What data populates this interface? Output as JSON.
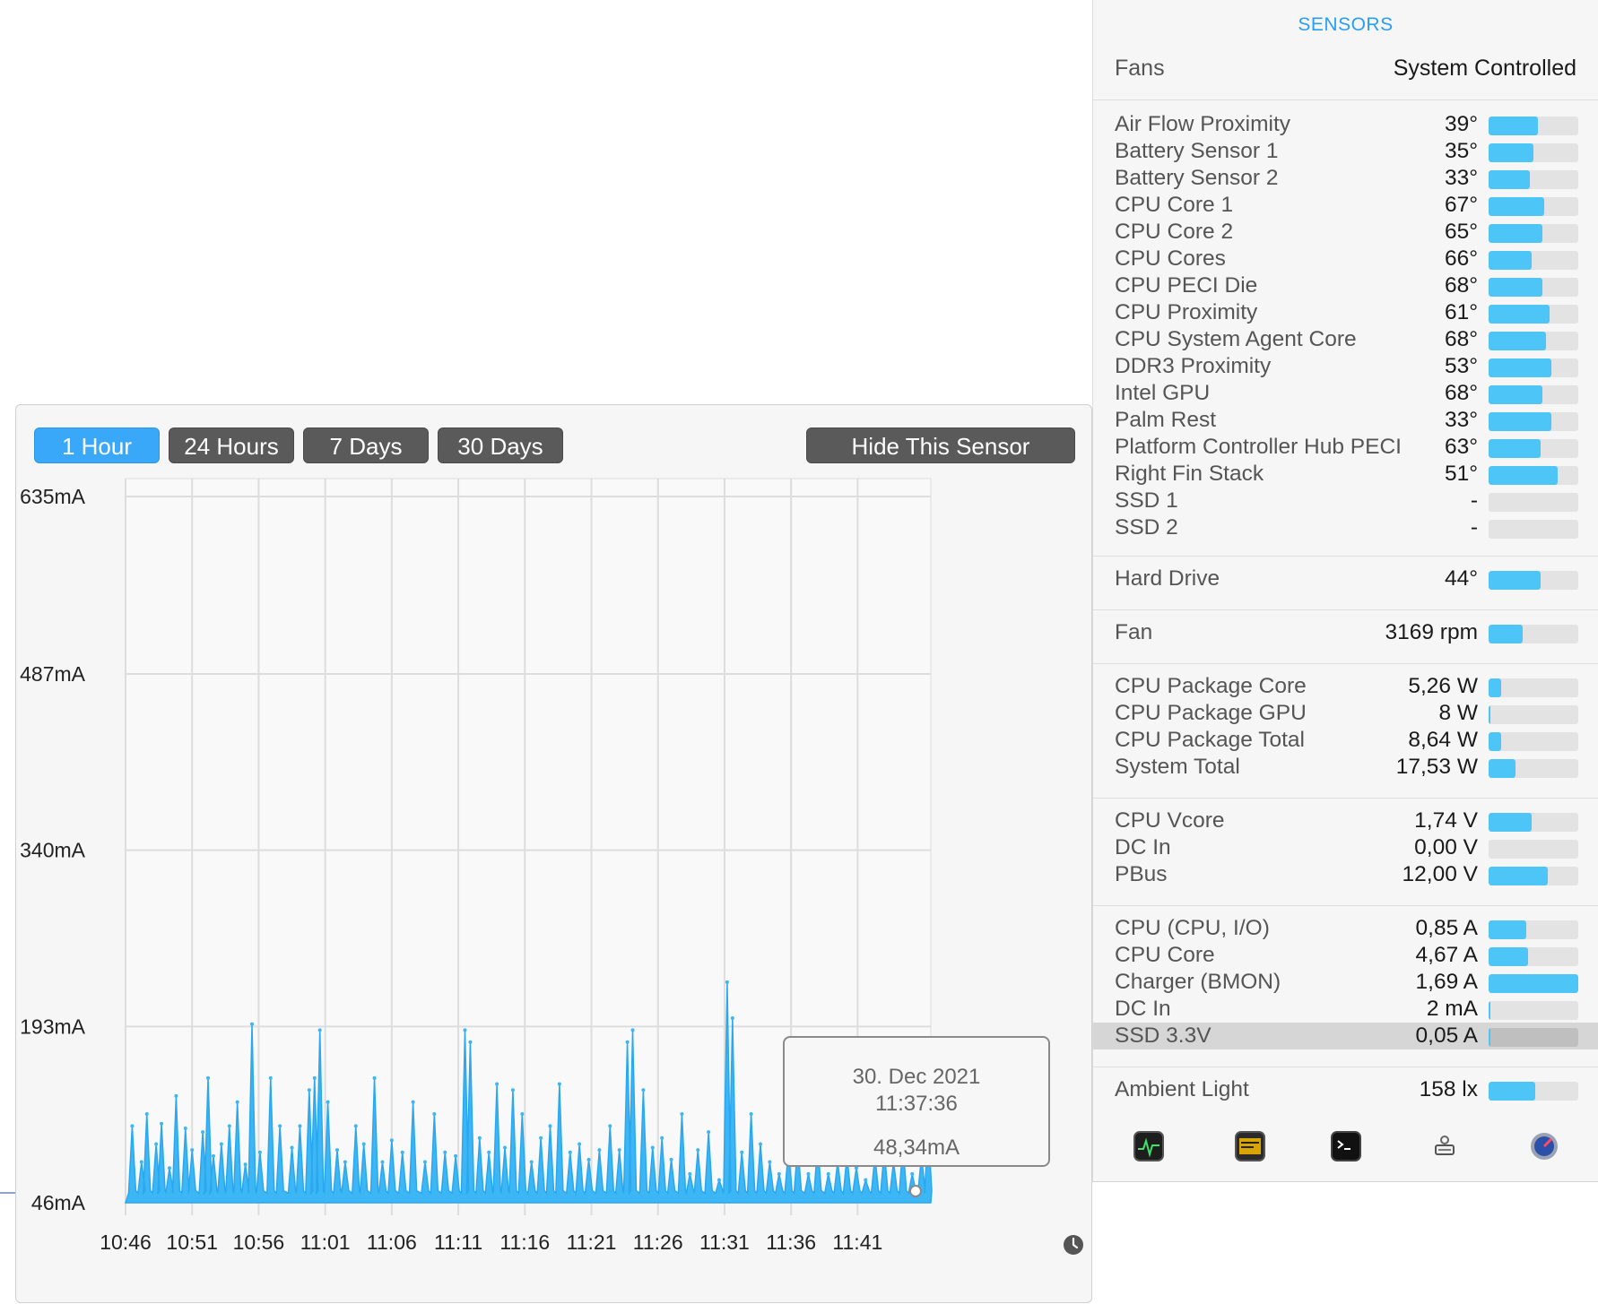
{
  "sensors": {
    "title": "SENSORS",
    "fans": {
      "label": "Fans",
      "value": "System Controlled"
    },
    "groups": [
      {
        "rows": [
          {
            "label": "Air Flow Proximity",
            "value": "39°",
            "level": 0.55
          },
          {
            "label": "Battery Sensor 1",
            "value": "35°",
            "level": 0.5
          },
          {
            "label": "Battery Sensor 2",
            "value": "33°",
            "level": 0.46
          },
          {
            "label": "CPU Core 1",
            "value": "67°",
            "level": 0.62
          },
          {
            "label": "CPU Core 2",
            "value": "65°",
            "level": 0.6
          },
          {
            "label": "CPU Cores",
            "value": "66°",
            "level": 0.48
          },
          {
            "label": "CPU PECI Die",
            "value": "68°",
            "level": 0.6
          },
          {
            "label": "CPU Proximity",
            "value": "61°",
            "level": 0.68
          },
          {
            "label": "CPU System Agent Core",
            "value": "68°",
            "level": 0.64
          },
          {
            "label": "DDR3 Proximity",
            "value": "53°",
            "level": 0.7
          },
          {
            "label": "Intel GPU",
            "value": "68°",
            "level": 0.6
          },
          {
            "label": "Palm Rest",
            "value": "33°",
            "level": 0.7
          },
          {
            "label": "Platform Controller Hub PECI",
            "value": "63°",
            "level": 0.58
          },
          {
            "label": "Right Fin Stack",
            "value": "51°",
            "level": 0.77
          },
          {
            "label": "SSD 1",
            "value": "-",
            "level": 0
          },
          {
            "label": "SSD 2",
            "value": "-",
            "level": 0
          }
        ]
      },
      {
        "rows": [
          {
            "label": "Hard Drive",
            "value": "44°",
            "level": 0.58
          }
        ]
      },
      {
        "rows": [
          {
            "label": "Fan",
            "value": "3169 rpm",
            "level": 0.38
          }
        ]
      },
      {
        "rows": [
          {
            "label": "CPU Package Core",
            "value": "5,26 W",
            "level": 0.14
          },
          {
            "label": "CPU Package GPU",
            "value": "8 W",
            "level": 0.02
          },
          {
            "label": "CPU Package Total",
            "value": "8,64 W",
            "level": 0.14
          },
          {
            "label": "System Total",
            "value": "17,53 W",
            "level": 0.3
          }
        ]
      },
      {
        "rows": [
          {
            "label": "CPU Vcore",
            "value": "1,74 V",
            "level": 0.48
          },
          {
            "label": "DC In",
            "value": "0,00 V",
            "level": 0
          },
          {
            "label": "PBus",
            "value": "12,00 V",
            "level": 0.66
          }
        ]
      },
      {
        "rows": [
          {
            "label": "CPU (CPU, I/O)",
            "value": "0,85 A",
            "level": 0.42
          },
          {
            "label": "CPU Core",
            "value": "4,67 A",
            "level": 0.44
          },
          {
            "label": "Charger (BMON)",
            "value": "1,69 A",
            "level": 1.0
          },
          {
            "label": "DC In",
            "value": "2 mA",
            "level": 0.02
          },
          {
            "label": "SSD 3.3V",
            "value": "0,05 A",
            "level": 0.02,
            "selected": true
          }
        ]
      },
      {
        "rows": [
          {
            "label": "Ambient Light",
            "value": "158 lx",
            "level": 0.52
          }
        ]
      }
    ],
    "dock_icons": [
      "activity-monitor-icon",
      "console-icon",
      "terminal-icon",
      "system-information-icon",
      "disk-utility-icon"
    ]
  },
  "chart_window": {
    "range_buttons": [
      "1 Hour",
      "24 Hours",
      "7 Days",
      "30 Days"
    ],
    "active_range": "1 Hour",
    "hide_button": "Hide This Sensor",
    "tooltip": {
      "date": "30. Dec 2021",
      "time": "11:37:36",
      "value": "48,34mA"
    }
  },
  "chart_data": {
    "type": "area",
    "title": "",
    "xlabel": "",
    "ylabel": "",
    "y_ticks": [
      "635mA",
      "487mA",
      "340mA",
      "193mA",
      "46mA"
    ],
    "y_tick_values": [
      635,
      487,
      340,
      193,
      46
    ],
    "x_ticks": [
      "10:46",
      "10:51",
      "10:56",
      "11:01",
      "11:06",
      "11:11",
      "11:16",
      "11:21",
      "11:26",
      "11:31",
      "11:36",
      "11:41"
    ],
    "xlim_minutes": [
      0,
      60.5
    ],
    "ylim": [
      46,
      635
    ],
    "grid": true,
    "color": "#3cb6f5",
    "spikes": [
      [
        0.5,
        110
      ],
      [
        1.2,
        80
      ],
      [
        1.6,
        120
      ],
      [
        2.3,
        95
      ],
      [
        2.7,
        112
      ],
      [
        3.3,
        75
      ],
      [
        3.8,
        135
      ],
      [
        4.5,
        108
      ],
      [
        5.0,
        90
      ],
      [
        5.8,
        105
      ],
      [
        6.2,
        150
      ],
      [
        6.6,
        85
      ],
      [
        7.2,
        95
      ],
      [
        7.8,
        110
      ],
      [
        8.4,
        130
      ],
      [
        9.0,
        78
      ],
      [
        9.5,
        195
      ],
      [
        10.1,
        88
      ],
      [
        10.9,
        150
      ],
      [
        11.6,
        110
      ],
      [
        12.5,
        92
      ],
      [
        13.1,
        110
      ],
      [
        13.8,
        140
      ],
      [
        14.2,
        150
      ],
      [
        14.6,
        190
      ],
      [
        15.2,
        130
      ],
      [
        15.9,
        90
      ],
      [
        16.5,
        80
      ],
      [
        17.3,
        110
      ],
      [
        17.9,
        95
      ],
      [
        18.7,
        150
      ],
      [
        19.3,
        80
      ],
      [
        20.0,
        98
      ],
      [
        20.8,
        88
      ],
      [
        21.6,
        130
      ],
      [
        22.5,
        80
      ],
      [
        23.2,
        120
      ],
      [
        24.0,
        88
      ],
      [
        24.8,
        85
      ],
      [
        25.5,
        190
      ],
      [
        25.9,
        180
      ],
      [
        26.6,
        100
      ],
      [
        27.3,
        88
      ],
      [
        27.9,
        145
      ],
      [
        28.5,
        92
      ],
      [
        29.1,
        140
      ],
      [
        29.8,
        120
      ],
      [
        30.5,
        80
      ],
      [
        31.2,
        100
      ],
      [
        31.9,
        110
      ],
      [
        32.6,
        145
      ],
      [
        33.4,
        88
      ],
      [
        34.1,
        95
      ],
      [
        34.8,
        82
      ],
      [
        35.6,
        90
      ],
      [
        36.4,
        110
      ],
      [
        37.1,
        90
      ],
      [
        37.7,
        180
      ],
      [
        38.1,
        190
      ],
      [
        38.9,
        140
      ],
      [
        39.6,
        92
      ],
      [
        40.3,
        100
      ],
      [
        41.0,
        82
      ],
      [
        41.8,
        120
      ],
      [
        42.4,
        70
      ],
      [
        43.0,
        90
      ],
      [
        43.8,
        105
      ],
      [
        44.6,
        65
      ],
      [
        45.2,
        230
      ],
      [
        45.6,
        200
      ],
      [
        46.3,
        88
      ],
      [
        47.0,
        120
      ],
      [
        47.7,
        95
      ],
      [
        48.4,
        80
      ],
      [
        49.1,
        70
      ],
      [
        49.8,
        90
      ],
      [
        50.5,
        95
      ],
      [
        51.3,
        70
      ],
      [
        52.0,
        95
      ],
      [
        52.8,
        70
      ],
      [
        53.5,
        80
      ],
      [
        54.2,
        85
      ],
      [
        54.9,
        75
      ],
      [
        55.6,
        65
      ],
      [
        56.3,
        85
      ],
      [
        57.0,
        90
      ],
      [
        57.7,
        80
      ],
      [
        58.4,
        95
      ],
      [
        59.1,
        70
      ],
      [
        59.8,
        85
      ],
      [
        60.3,
        108
      ]
    ]
  }
}
